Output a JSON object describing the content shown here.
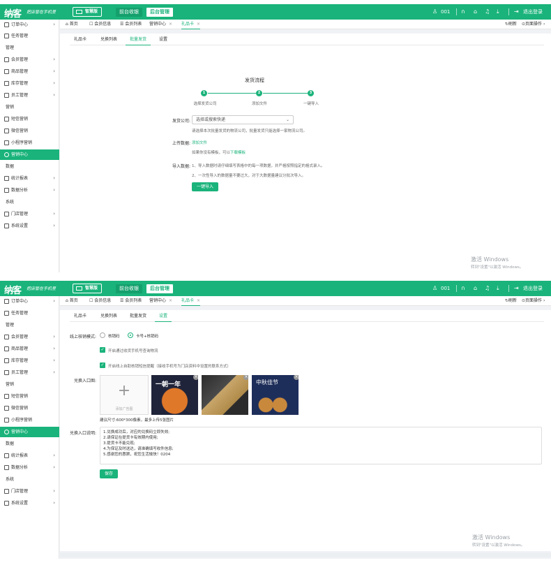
{
  "header": {
    "logo": "纳客",
    "slogan": "把店管在手机里",
    "wx_label": "智慧版",
    "nav_tabs": [
      "前台收银",
      "后台管理"
    ],
    "store_num": "001",
    "logout": "退出登录"
  },
  "sidebar": {
    "items": [
      {
        "type": "item",
        "label": "订单中心",
        "icon": "globe-icon",
        "arrow": true
      },
      {
        "type": "item",
        "label": "任务管理",
        "icon": "task-icon",
        "arrow": false
      },
      {
        "type": "head",
        "label": "管理"
      },
      {
        "type": "item",
        "label": "会员管理",
        "icon": "member-icon",
        "arrow": true
      },
      {
        "type": "item",
        "label": "商品管理",
        "icon": "goods-icon",
        "arrow": true
      },
      {
        "type": "item",
        "label": "库存管理",
        "icon": "stock-icon",
        "arrow": true
      },
      {
        "type": "item",
        "label": "员工管理",
        "icon": "staff-icon",
        "arrow": true
      },
      {
        "type": "head",
        "label": "营销"
      },
      {
        "type": "item",
        "label": "短信营销",
        "icon": "sms-icon",
        "arrow": false
      },
      {
        "type": "item",
        "label": "微信营销",
        "icon": "wechat-icon",
        "arrow": false
      },
      {
        "type": "item",
        "label": "小程序营销",
        "icon": "miniapp-icon",
        "arrow": false
      },
      {
        "type": "item",
        "label": "营销中心",
        "icon": "marketing-icon",
        "arrow": false,
        "active": true
      },
      {
        "type": "head",
        "label": "数据"
      },
      {
        "type": "item",
        "label": "统计报表",
        "icon": "report-icon",
        "arrow": true
      },
      {
        "type": "item",
        "label": "数据分析",
        "icon": "analysis-icon",
        "arrow": true
      },
      {
        "type": "head",
        "label": "系统"
      },
      {
        "type": "item",
        "label": "门店管理",
        "icon": "store-icon",
        "arrow": true
      },
      {
        "type": "item",
        "label": "系统设置",
        "icon": "gear-icon",
        "arrow": true
      }
    ]
  },
  "page_tabs": {
    "items": [
      "首页",
      "会员信息",
      "会员列表",
      "营销中心",
      "礼品卡"
    ],
    "refresh": "刷新",
    "page_ops": "页面操作"
  },
  "sub_tabs": [
    "礼品卡",
    "兑换列表",
    "批量发货",
    "设置"
  ],
  "shipping": {
    "title": "发货流程",
    "steps": [
      {
        "num": "1",
        "label": "选择发货公司"
      },
      {
        "num": "2",
        "label": "添加文件"
      },
      {
        "num": "3",
        "label": "一键导入"
      }
    ],
    "company_label": "发货公司:",
    "company_placeholder": "选择或搜索快递",
    "company_hint": "请选择本次批量发货的物流公司，批量发货只能选择一家物流公司。",
    "upload_label": "上传数据:",
    "upload_link": "添加文件",
    "template_hint_prefix": "如果你没有模板，可以",
    "template_link": "下载模板",
    "import_label": "导入数据:",
    "import_note1": "1、导入数据时请仔细填写表格中的每一项数据，并严格按照指定的格式录入。",
    "import_note2": "2、一次性导入的数据量不要过大，对于大数据量建议分批次导入。",
    "import_button": "一键导入"
  },
  "settings": {
    "verify_label": "线上核销模式:",
    "radio1": "核销码",
    "radio2": "卡号+核销码",
    "check1": "开启通过收货手机号查询物流",
    "check2": "开启线上自助核销短信提醒（接收手机号为门店资料中设置的联系方式）",
    "entry_img_label": "兑换入口图:",
    "upload_tip": "添加广告图",
    "size_hint": "建议尺寸:600*300像素，最多上传5张图片",
    "desc_label": "兑换入口说明:",
    "desc_lines": [
      "1.兑换成功后，对应的兑换码立即失效;",
      "2.请保证在提货卡有效期内使用;",
      "3.提货卡不能兑现;",
      "4.为保证及时送达，请准确填写收件信息;",
      "5.感谢您的惠顾，祝您生活愉快！0204"
    ],
    "save_button": "保存",
    "image_captions": [
      "一朝一年",
      "",
      "中秋佳节"
    ]
  },
  "watermark": {
    "line1": "激活 Windows",
    "line2": "转到\"设置\"以激活 Windows。"
  },
  "colors": {
    "brand": "#1ab37b",
    "active_tab": "#14a06d"
  }
}
